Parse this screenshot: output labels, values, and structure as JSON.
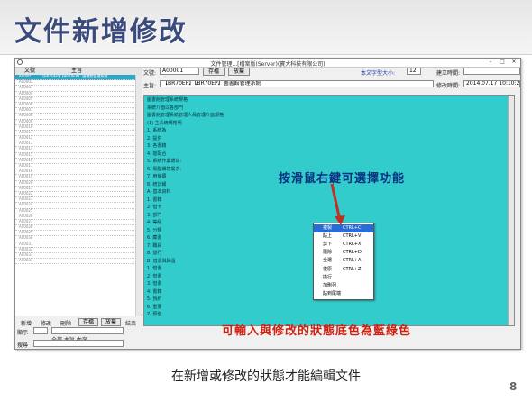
{
  "slide": {
    "title": "文件新增修改",
    "caption": "在新增或修改的狀態才能編輯文件",
    "page_number": "8"
  },
  "window": {
    "title": "文件管理...[檔案版(Server)(寶大科技有限公司)",
    "minimize": "–",
    "maximize": "□",
    "close": "✕"
  },
  "left_panel": {
    "col_id": "文號",
    "col_title": "主旨",
    "rows": [
      {
        "id": "A00001",
        "title": "【BR70EP】【BR70EP】 圖書館管理系統",
        "selected": true
      },
      {
        "id": "A00002",
        "title": "",
        "selected": false
      },
      {
        "id": "A00003",
        "title": "",
        "selected": false
      },
      {
        "id": "A00004",
        "title": "",
        "selected": false
      },
      {
        "id": "A00005",
        "title": "",
        "selected": false
      },
      {
        "id": "A00006",
        "title": "",
        "selected": false
      },
      {
        "id": "A00007",
        "title": "",
        "selected": false
      },
      {
        "id": "A00008",
        "title": "",
        "selected": false
      },
      {
        "id": "A00009",
        "title": "",
        "selected": false
      },
      {
        "id": "A00010",
        "title": "",
        "selected": false
      },
      {
        "id": "A00011",
        "title": "",
        "selected": false
      },
      {
        "id": "A00012",
        "title": "",
        "selected": false
      },
      {
        "id": "A00013",
        "title": "",
        "selected": false
      },
      {
        "id": "A00014",
        "title": "",
        "selected": false
      },
      {
        "id": "A00015",
        "title": "",
        "selected": false
      },
      {
        "id": "A00016",
        "title": "",
        "selected": false
      },
      {
        "id": "A00017",
        "title": "",
        "selected": false
      },
      {
        "id": "A00018",
        "title": "",
        "selected": false
      },
      {
        "id": "A00019",
        "title": "",
        "selected": false
      },
      {
        "id": "A00020",
        "title": "",
        "selected": false
      },
      {
        "id": "A00021",
        "title": "",
        "selected": false
      },
      {
        "id": "A00022",
        "title": "",
        "selected": false
      },
      {
        "id": "A00023",
        "title": "",
        "selected": false
      },
      {
        "id": "A00024",
        "title": "",
        "selected": false
      },
      {
        "id": "A00025",
        "title": "",
        "selected": false
      },
      {
        "id": "A00026",
        "title": "",
        "selected": false
      },
      {
        "id": "A00027",
        "title": "",
        "selected": false
      },
      {
        "id": "A00028",
        "title": "",
        "selected": false
      },
      {
        "id": "A00029",
        "title": "",
        "selected": false
      },
      {
        "id": "A00030",
        "title": "",
        "selected": false
      },
      {
        "id": "A00031",
        "title": "",
        "selected": false
      },
      {
        "id": "A00032",
        "title": "",
        "selected": false
      },
      {
        "id": "A00033",
        "title": "",
        "selected": false
      },
      {
        "id": "A00034",
        "title": "",
        "selected": false
      }
    ]
  },
  "form": {
    "doc_no_label": "文號:",
    "doc_no_value": "A00001",
    "save_label": "存檔",
    "cancel_label": "放棄",
    "font_size_label": "本文字型大小:",
    "font_size_value": "12",
    "created_label": "建立時間:",
    "created_value": "",
    "subject_label": "主旨:",
    "subject_value": "【BR70EP】【BR70EP】圖書館管理系統",
    "modified_label": "修改時間:",
    "modified_value": "2014.07.17 10:10:22"
  },
  "editor": {
    "lines": [
      "圖書館管理系統規格",
      "系統介面以各部門",
      "圖書館管理系統管理人員管理介面規格",
      "(1) 主系統規格明",
      "1. 系統為",
      "2. 提供",
      "3. 各書籍",
      "4. 能配合",
      "5. 系統作業環境:",
      "6. 電腦環境需求:",
      "7. 用條碼",
      "8. 統計報",
      "A. 基本資料",
      "1. 書籍",
      "2. 借卡",
      "3. 部門",
      "4. 等級",
      "5. 分類",
      "6. 藏書",
      "7. 職員",
      "8. 發行",
      "B. 借書與歸還",
      "1. 借書",
      "2. 借書",
      "3. 借書",
      "4. 書籍",
      "5. 預約",
      "6. 重要",
      "7. 預借"
    ]
  },
  "context_menu": {
    "items": [
      {
        "label": "複製",
        "shortcut": "CTRL+C",
        "selected": true
      },
      {
        "label": "貼上",
        "shortcut": "CTRL+V",
        "selected": false
      },
      {
        "label": "剪下",
        "shortcut": "CTRL+X",
        "selected": false
      },
      {
        "label": "刪除",
        "shortcut": "CTRL+D",
        "selected": false
      },
      {
        "label": "全選",
        "shortcut": "CTRL+A",
        "selected": false
      },
      {
        "label": "復原",
        "shortcut": "CTRL+Z",
        "selected": false
      },
      {
        "label": "換行",
        "shortcut": "",
        "selected": false
      },
      {
        "label": "加刪列",
        "shortcut": "",
        "selected": false
      },
      {
        "label": "貼到尾端",
        "shortcut": "",
        "selected": false
      }
    ]
  },
  "bottom_toolbar": {
    "new": "新增",
    "edit": "修改",
    "delete": "刪除",
    "save": "存檔",
    "cancel": "放棄",
    "exit": "結束"
  },
  "status": {
    "display_label": "顯示",
    "find_label": "搜尋",
    "find_extra": "全部 主旨 內容"
  },
  "annotations": {
    "right_click": "按滑鼠右鍵可選擇功能",
    "edit_color": "可輸入與修改的狀態底色為藍綠色"
  },
  "colors": {
    "editor_bg": "#33cccc",
    "selected_row": "#28a7c8",
    "title_text": "#3a4a7a",
    "annot_blue": "#0a3080",
    "annot_red": "#d02010"
  }
}
